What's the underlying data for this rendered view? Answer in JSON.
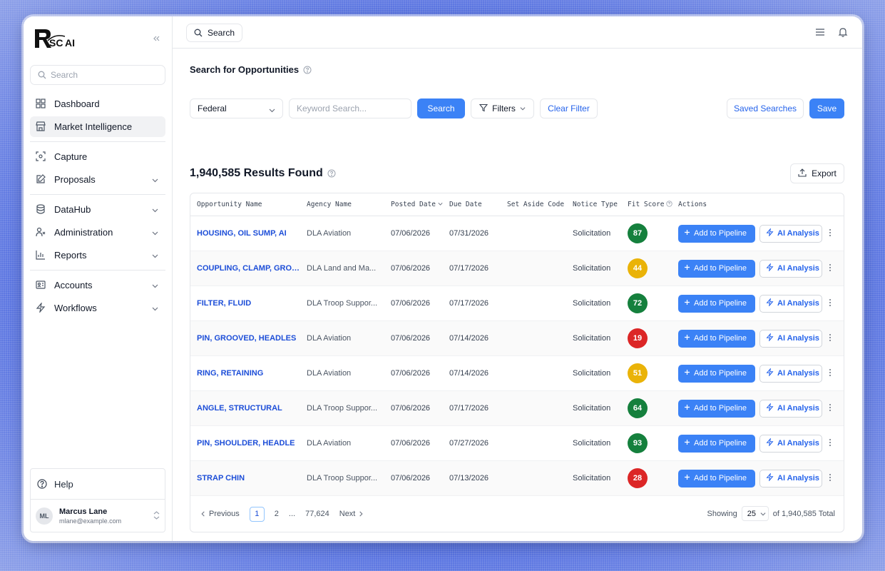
{
  "colors": {
    "primary": "#3b82f6",
    "link": "#1d4ed8",
    "score_green": "#15803d",
    "score_yellow": "#eab308",
    "score_red": "#dc2626"
  },
  "brand": {
    "name": "RSC AI"
  },
  "sidebar": {
    "search_placeholder": "Search",
    "items": [
      {
        "label": "Dashboard",
        "icon": "grid-icon"
      },
      {
        "label": "Market Intelligence",
        "icon": "store-icon"
      },
      {
        "label": "Capture",
        "icon": "scan-icon"
      },
      {
        "label": "Proposals",
        "icon": "edit-icon"
      },
      {
        "label": "DataHub",
        "icon": "database-icon"
      },
      {
        "label": "Administration",
        "icon": "users-icon"
      },
      {
        "label": "Reports",
        "icon": "bar-chart-icon"
      },
      {
        "label": "Accounts",
        "icon": "id-card-icon"
      },
      {
        "label": "Workflows",
        "icon": "zap-icon"
      }
    ],
    "help_label": "Help",
    "user": {
      "initials": "ML",
      "name": "Marcus Lane",
      "email": "mlane@example.com"
    }
  },
  "topbar": {
    "search_label": "Search"
  },
  "main": {
    "title": "Search for Opportunities",
    "filters": {
      "scope": "Federal",
      "keyword_placeholder": "Keyword Search...",
      "search_button": "Search",
      "filters_button": "Filters",
      "clear_button": "Clear Filter",
      "saved_button": "Saved Searches",
      "save_button": "Save"
    },
    "results_title": "1,940,585 Results Found",
    "export_button": "Export",
    "columns": [
      "Opportunity Name",
      "Agency Name",
      "Posted Date",
      "Due Date",
      "Set Aside Code",
      "Notice Type",
      "Fit Score",
      "Actions"
    ],
    "rows": [
      {
        "name": "HOUSING, OIL SUMP, AI",
        "agency": "DLA Aviation",
        "posted": "07/06/2026",
        "due": "07/31/2026",
        "set_aside": "",
        "notice": "Solicitation",
        "score": "87",
        "score_color": "#15803d"
      },
      {
        "name": "COUPLING, CLAMP, GROO...",
        "agency": "DLA Land and Ma...",
        "posted": "07/06/2026",
        "due": "07/17/2026",
        "set_aside": "",
        "notice": "Solicitation",
        "score": "44",
        "score_color": "#eab308"
      },
      {
        "name": "FILTER, FLUID",
        "agency": "DLA Troop Suppor...",
        "posted": "07/06/2026",
        "due": "07/17/2026",
        "set_aside": "",
        "notice": "Solicitation",
        "score": "72",
        "score_color": "#15803d"
      },
      {
        "name": "PIN, GROOVED, HEADLES",
        "agency": "DLA Aviation",
        "posted": "07/06/2026",
        "due": "07/14/2026",
        "set_aside": "",
        "notice": "Solicitation",
        "score": "19",
        "score_color": "#dc2626"
      },
      {
        "name": "RING, RETAINING",
        "agency": "DLA Aviation",
        "posted": "07/06/2026",
        "due": "07/14/2026",
        "set_aside": "",
        "notice": "Solicitation",
        "score": "51",
        "score_color": "#eab308"
      },
      {
        "name": "ANGLE, STRUCTURAL",
        "agency": "DLA Troop Suppor...",
        "posted": "07/06/2026",
        "due": "07/17/2026",
        "set_aside": "",
        "notice": "Solicitation",
        "score": "64",
        "score_color": "#15803d"
      },
      {
        "name": "PIN, SHOULDER, HEADLE",
        "agency": "DLA Aviation",
        "posted": "07/06/2026",
        "due": "07/27/2026",
        "set_aside": "",
        "notice": "Solicitation",
        "score": "93",
        "score_color": "#15803d"
      },
      {
        "name": "STRAP CHIN",
        "agency": "DLA Troop Suppor...",
        "posted": "07/06/2026",
        "due": "07/13/2026",
        "set_aside": "",
        "notice": "Solicitation",
        "score": "28",
        "score_color": "#dc2626"
      }
    ],
    "row_actions": {
      "pipeline": "Add to Pipeline",
      "ai": "AI Analysis"
    },
    "pagination": {
      "previous": "Previous",
      "next": "Next",
      "pages": [
        "1",
        "2",
        "...",
        "77,624"
      ],
      "current": "1",
      "showing_label": "Showing",
      "per_page": "25",
      "total_label": "of 1,940,585 Total"
    }
  }
}
